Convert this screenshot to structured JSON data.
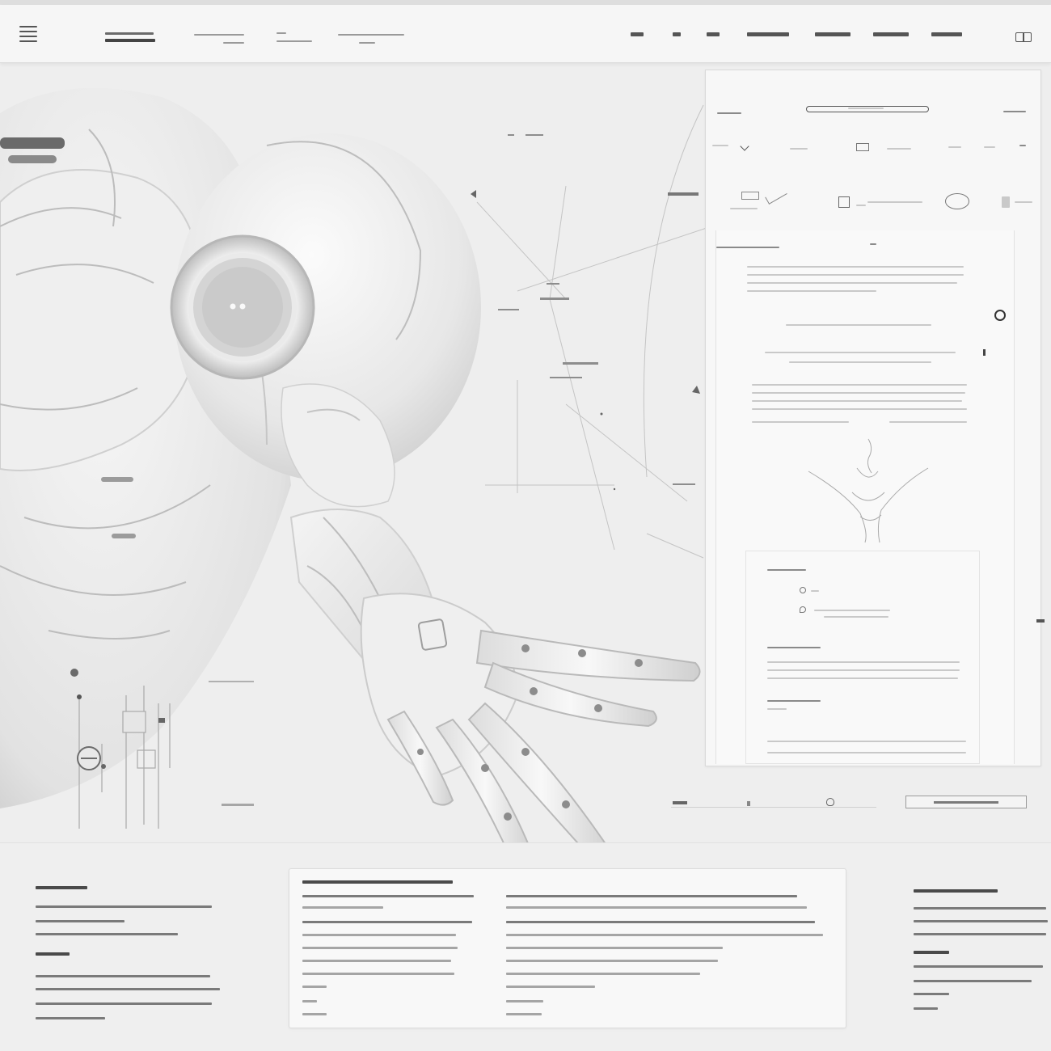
{
  "header": {
    "menu_icon": "hamburger-menu-icon",
    "right_icon": "book-icon",
    "nav_item_count_visible": 7
  },
  "artwork": {
    "subject": "robot-reaching-hand",
    "palette": {
      "background": "#eeeeee",
      "robot": "#f2f2f2",
      "shadow": "#c8c8c8",
      "line": "#9a9a9a"
    }
  },
  "panel": {
    "icons": [
      "pin-icon",
      "chevron-icon",
      "nav-icon",
      "target-icon"
    ]
  },
  "colors": {
    "page": "#eeeeee",
    "panel": "#f7f7f7",
    "text_dark": "#4a4a4a",
    "text_light": "#a5a5a5"
  }
}
